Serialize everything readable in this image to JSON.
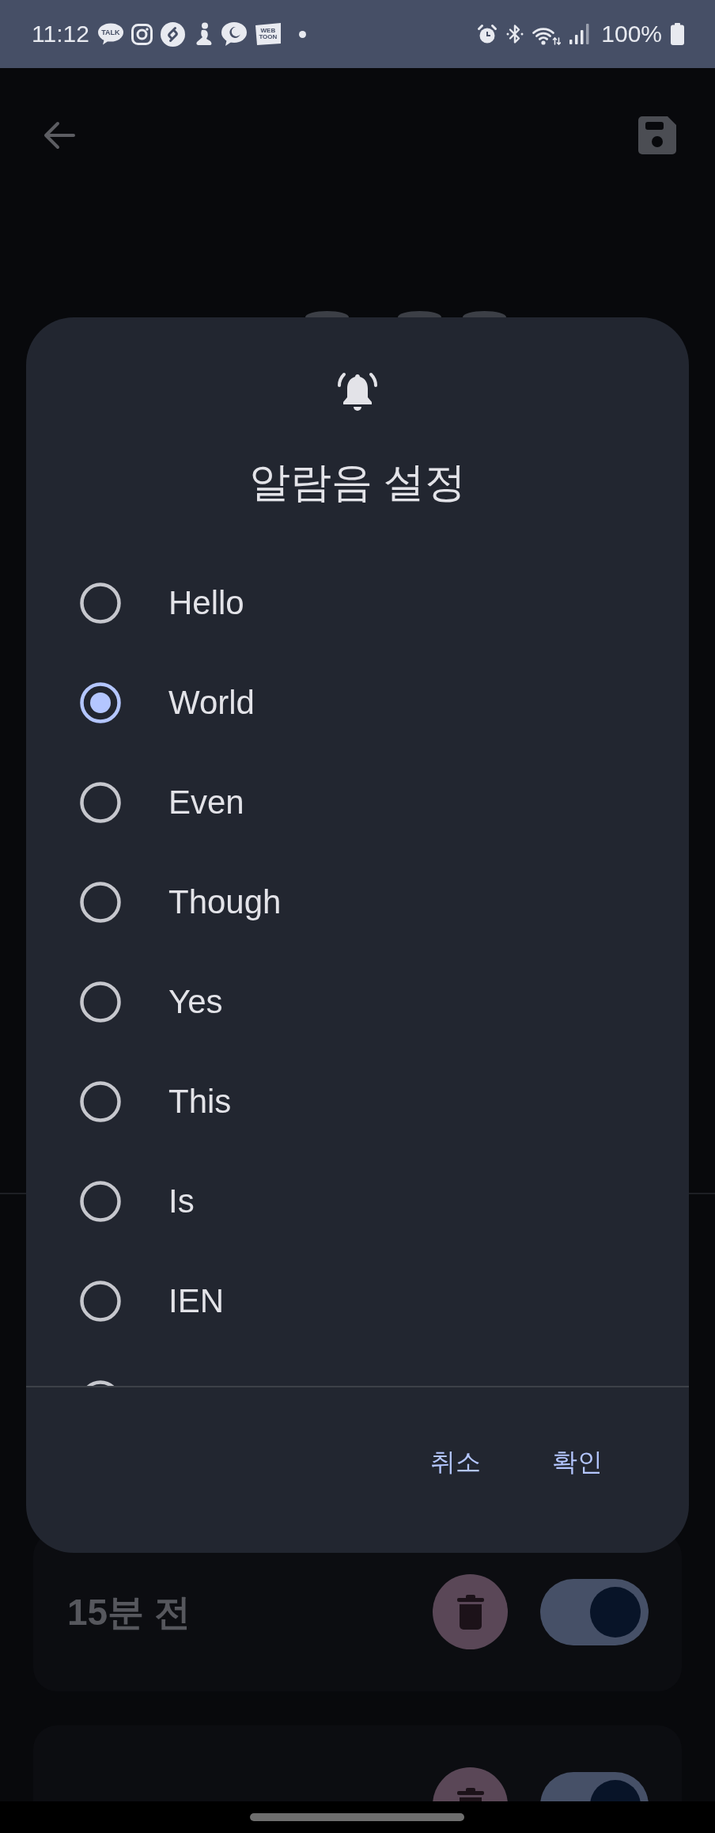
{
  "status_bar": {
    "time": "11:12",
    "notifications": [
      {
        "kind": "talk",
        "label": "TALK"
      },
      {
        "kind": "instagram"
      },
      {
        "kind": "shazam"
      },
      {
        "kind": "figure"
      },
      {
        "kind": "moon-chat"
      },
      {
        "kind": "webtoon",
        "lines": [
          "WEB",
          "TOON"
        ]
      },
      {
        "kind": "dot"
      }
    ],
    "system_icons": [
      {
        "kind": "alarm"
      },
      {
        "kind": "bluetooth"
      },
      {
        "kind": "wifi"
      },
      {
        "kind": "signal"
      }
    ],
    "battery": "100%"
  },
  "dialog": {
    "title": "알람음 설정",
    "options": [
      {
        "kind": "radio",
        "label": "Hello",
        "selected": false
      },
      {
        "kind": "radio",
        "label": "World",
        "selected": true
      },
      {
        "kind": "radio",
        "label": "Even",
        "selected": false
      },
      {
        "kind": "radio",
        "label": "Though",
        "selected": false
      },
      {
        "kind": "radio",
        "label": "Yes",
        "selected": false
      },
      {
        "kind": "radio",
        "label": "This",
        "selected": false
      },
      {
        "kind": "radio",
        "label": "Is",
        "selected": false
      },
      {
        "kind": "radio",
        "label": "IEN",
        "selected": false
      },
      {
        "kind": "cut-off",
        "selected": false
      }
    ],
    "buttons": [
      "취소",
      "확인"
    ]
  },
  "reminders": [
    {
      "label": "15분 전",
      "on": true
    },
    {
      "on": true
    }
  ]
}
